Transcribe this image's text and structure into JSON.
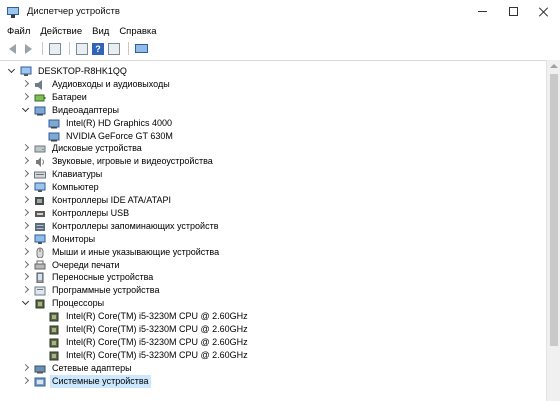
{
  "window": {
    "title": "Диспетчер устройств",
    "icon": "device-manager-icon",
    "controls": [
      "minimize-icon",
      "maximize-icon",
      "close-icon"
    ]
  },
  "menu": [
    "Файл",
    "Действие",
    "Вид",
    "Справка"
  ],
  "toolbar": [
    "back-arrow-icon",
    "forward-arrow-icon",
    "properties-icon",
    "update-driver-icon",
    "help-icon",
    "view-icon",
    "monitor-icon"
  ],
  "tree": {
    "root": "DESKTOP-R8HK1QQ",
    "categories": [
      {
        "label": "Аудиовходы и аудиовыходы",
        "icon": "speaker-icon",
        "expanded": false
      },
      {
        "label": "Батареи",
        "icon": "battery-icon",
        "expanded": false
      },
      {
        "label": "Видеоадаптеры",
        "icon": "display-adapter-icon",
        "expanded": true,
        "children": [
          "Intel(R) HD Graphics 4000",
          "NVIDIA GeForce GT 630M"
        ]
      },
      {
        "label": "Дисковые устройства",
        "icon": "disk-drive-icon",
        "expanded": false
      },
      {
        "label": "Звуковые, игровые и видеоустройства",
        "icon": "sound-icon",
        "expanded": false
      },
      {
        "label": "Клавиатуры",
        "icon": "keyboard-icon",
        "expanded": false
      },
      {
        "label": "Компьютер",
        "icon": "computer-icon",
        "expanded": false
      },
      {
        "label": "Контроллеры IDE ATA/ATAPI",
        "icon": "ide-controller-icon",
        "expanded": false
      },
      {
        "label": "Контроллеры USB",
        "icon": "usb-icon",
        "expanded": false
      },
      {
        "label": "Контроллеры запоминающих устройств",
        "icon": "storage-controller-icon",
        "expanded": false
      },
      {
        "label": "Мониторы",
        "icon": "monitor-icon",
        "expanded": false
      },
      {
        "label": "Мыши и иные указывающие устройства",
        "icon": "mouse-icon",
        "expanded": false
      },
      {
        "label": "Очереди печати",
        "icon": "printer-icon",
        "expanded": false
      },
      {
        "label": "Переносные устройства",
        "icon": "portable-device-icon",
        "expanded": false
      },
      {
        "label": "Программные устройства",
        "icon": "software-device-icon",
        "expanded": false
      },
      {
        "label": "Процессоры",
        "icon": "processor-icon",
        "expanded": true,
        "children": [
          "Intel(R) Core(TM) i5-3230M CPU @ 2.60GHz",
          "Intel(R) Core(TM) i5-3230M CPU @ 2.60GHz",
          "Intel(R) Core(TM) i5-3230M CPU @ 2.60GHz",
          "Intel(R) Core(TM) i5-3230M CPU @ 2.60GHz"
        ]
      },
      {
        "label": "Сетевые адаптеры",
        "icon": "network-adapter-icon",
        "expanded": false
      },
      {
        "label": "Системные устройства",
        "icon": "system-device-icon",
        "expanded": false,
        "selected": true
      }
    ]
  },
  "colors": {
    "selection": "#cce8ff",
    "icon_blue": "#3f7fc8"
  }
}
